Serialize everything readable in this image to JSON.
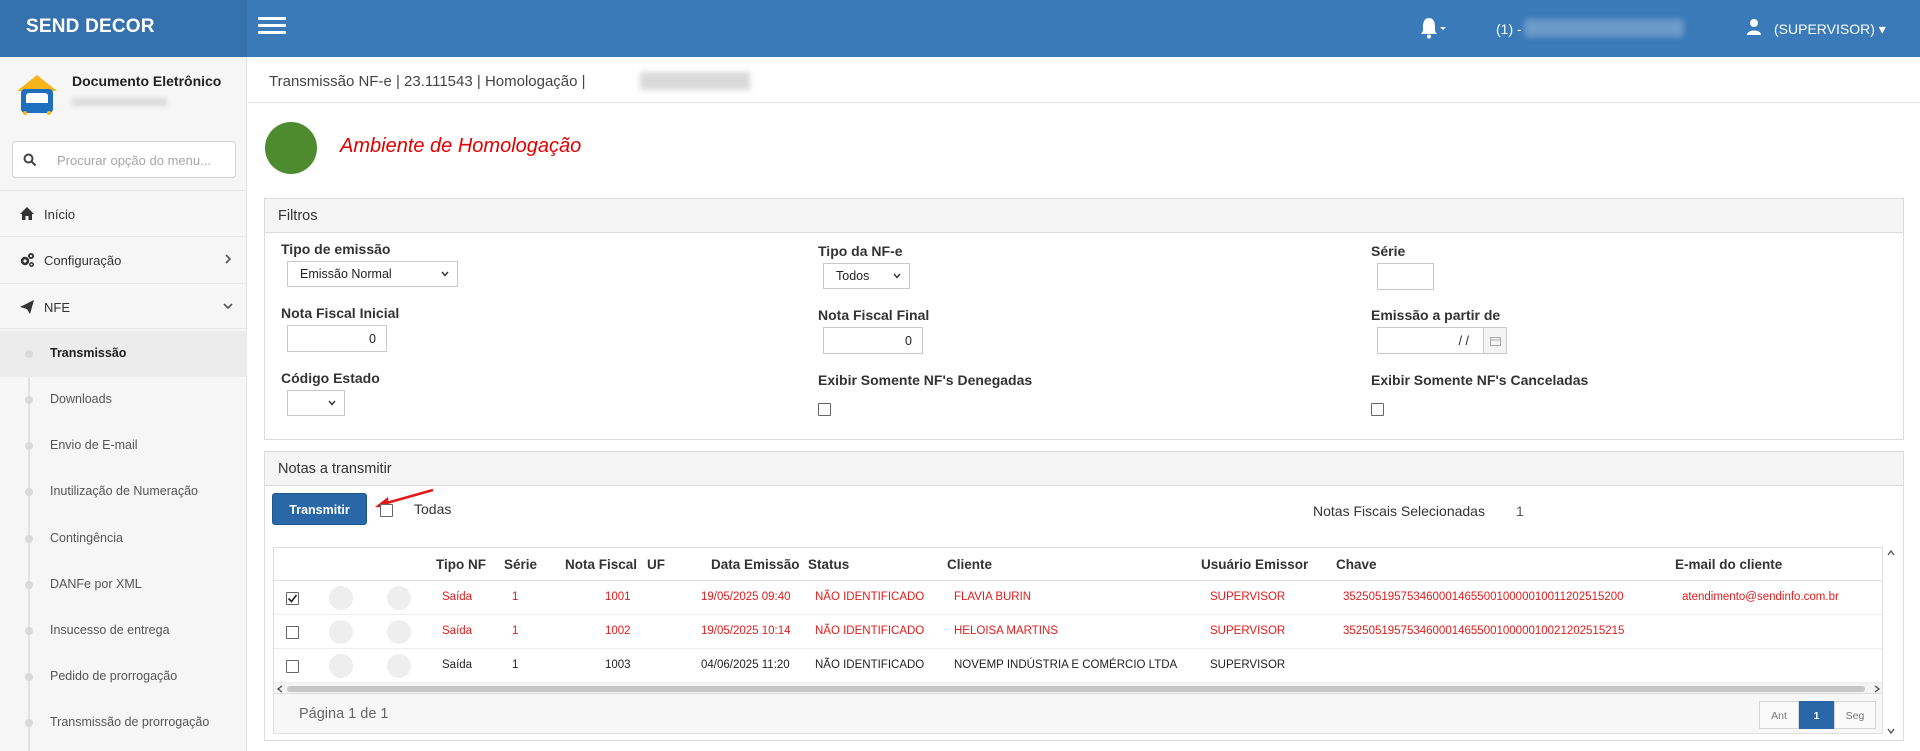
{
  "app": {
    "brand": "SEND DECOR",
    "notif_count": "(1) -",
    "user": "(SUPERVISOR)"
  },
  "sidebar": {
    "title": "Documento Eletrônico",
    "search_placeholder": "Procurar opção do menu...",
    "menu": [
      {
        "label": "Início",
        "icon": "home-icon"
      },
      {
        "label": "Configuração",
        "icon": "cogs-icon"
      },
      {
        "label": "NFE",
        "icon": "paper-plane-icon"
      }
    ],
    "submenu": [
      "Transmissão",
      "Downloads",
      "Envio de E-mail",
      "Inutilização de Numeração",
      "Contingência",
      "DANFe por XML",
      "Insucesso de entrega",
      "Pedido de prorrogação",
      "Transmissão de prorrogação"
    ],
    "active_sub": "Transmissão"
  },
  "breadcrumb": "Transmissão NF-e | 23.111543 | Homologação |",
  "environment": {
    "label": "Ambiente de Homologação",
    "status_color": "#4e8b2e"
  },
  "filters": {
    "title": "Filtros",
    "tipo_emissao_label": "Tipo de emissão",
    "tipo_emissao_value": "Emissão Normal",
    "tipo_nfe_label": "Tipo da NF-e",
    "tipo_nfe_value": "Todos",
    "serie_label": "Série",
    "serie_value": "",
    "nf_inicial_label": "Nota Fiscal Inicial",
    "nf_inicial_value": "0",
    "nf_final_label": "Nota Fiscal Final",
    "nf_final_value": "0",
    "emissao_label": "Emissão a partir de",
    "emissao_value": "/ /",
    "codigo_estado_label": "Código Estado",
    "codigo_estado_value": "",
    "denegadas_label": "Exibir Somente NF's Denegadas",
    "canceladas_label": "Exibir Somente NF's Canceladas"
  },
  "notas": {
    "title": "Notas a transmitir",
    "transmit_label": "Transmitir",
    "todas_label": "Todas",
    "selected_label": "Notas Fiscais Selecionadas",
    "selected_count": "1",
    "columns": [
      "Tipo NF",
      "Série",
      "Nota Fiscal",
      "UF",
      "Data Emissão",
      "Status",
      "Cliente",
      "Usuário Emissor",
      "Chave",
      "E-mail do cliente"
    ],
    "rows": [
      {
        "checked": true,
        "tipo": "Saída",
        "serie": "1",
        "nota": "1001",
        "uf": "",
        "data": "19/05/2025 09:40",
        "status": "NÃO IDENTIFICADO",
        "cliente": "FLAVIA BURIN",
        "usuario": "SUPERVISOR",
        "chave": "35250519575346000146550010000010011202515200",
        "email": "atendimento@sendinfo.com.br",
        "highlight": "red"
      },
      {
        "checked": false,
        "tipo": "Saída",
        "serie": "1",
        "nota": "1002",
        "uf": "",
        "data": "19/05/2025 10:14",
        "status": "NÃO IDENTIFICADO",
        "cliente": "HELOISA MARTINS",
        "usuario": "SUPERVISOR",
        "chave": "35250519575346000146550010000010021202515215",
        "email": "",
        "highlight": "red"
      },
      {
        "checked": false,
        "tipo": "Saída",
        "serie": "1",
        "nota": "1003",
        "uf": "",
        "data": "04/06/2025 11:20",
        "status": "NÃO IDENTIFICADO",
        "cliente": "NOVEMP INDÚSTRIA E COMÉRCIO LTDA",
        "usuario": "SUPERVISOR",
        "chave": "",
        "email": "",
        "highlight": "black"
      }
    ],
    "pager_text": "Página 1 de 1",
    "pager_prev": "Ant",
    "pager_page": "1",
    "pager_next": "Seg"
  }
}
